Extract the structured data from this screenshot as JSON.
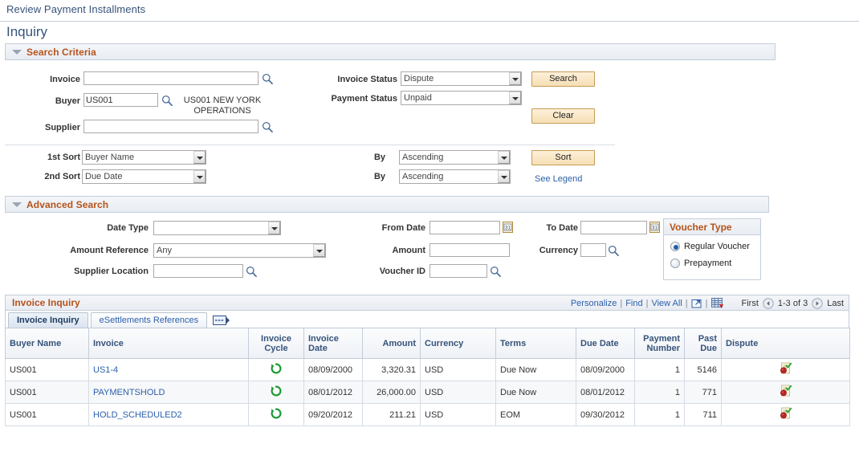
{
  "breadcrumb": "Review Payment Installments",
  "page_title": "Inquiry",
  "search_criteria": {
    "section_title": "Search Criteria",
    "invoice_label": "Invoice",
    "invoice_value": "",
    "buyer_label": "Buyer",
    "buyer_value": "US001",
    "buyer_description": "US001 NEW YORK OPERATIONS",
    "supplier_label": "Supplier",
    "supplier_value": "",
    "invoice_status_label": "Invoice Status",
    "invoice_status_value": "Dispute",
    "payment_status_label": "Payment Status",
    "payment_status_value": "Unpaid",
    "search_button": "Search",
    "clear_button": "Clear"
  },
  "sort": {
    "first_sort_label": "1st Sort",
    "first_sort_value": "Buyer Name",
    "second_sort_label": "2nd Sort",
    "second_sort_value": "Due Date",
    "by_label_1": "By",
    "by_value_1": "Ascending",
    "by_label_2": "By",
    "by_value_2": "Ascending",
    "sort_button": "Sort",
    "see_legend_link": "See Legend"
  },
  "advanced_search": {
    "section_title": "Advanced Search",
    "date_type_label": "Date Type",
    "date_type_value": "",
    "amount_reference_label": "Amount Reference",
    "amount_reference_value": "Any",
    "supplier_location_label": "Supplier Location",
    "supplier_location_value": "",
    "from_date_label": "From Date",
    "from_date_value": "",
    "amount_label": "Amount",
    "amount_value": "",
    "voucher_id_label": "Voucher ID",
    "voucher_id_value": "",
    "to_date_label": "To Date",
    "to_date_value": "",
    "currency_label": "Currency",
    "currency_value": "",
    "voucher_type": {
      "title": "Voucher Type",
      "options": [
        "Regular Voucher",
        "Prepayment"
      ],
      "selected": "Regular Voucher"
    }
  },
  "grid": {
    "title": "Invoice Inquiry",
    "tools": {
      "personalize": "Personalize",
      "find": "Find",
      "view_all": "View All",
      "first": "First",
      "range": "1-3 of 3",
      "last": "Last"
    },
    "tabs": [
      {
        "label": "Invoice Inquiry",
        "active": true
      },
      {
        "label": "eSettlements References",
        "active": false
      }
    ],
    "columns": [
      "Buyer Name",
      "Invoice",
      "Invoice Cycle",
      "Invoice Date",
      "Amount",
      "Currency",
      "Terms",
      "Due Date",
      "Payment Number",
      "Past Due",
      "Dispute"
    ],
    "rows": [
      {
        "buyer_name": "US001",
        "invoice": "US1-4",
        "invoice_cycle": "cycle-icon",
        "invoice_date": "08/09/2000",
        "amount": "3,320.31",
        "currency": "USD",
        "terms": "Due Now",
        "due_date": "08/09/2000",
        "payment_number": "1",
        "past_due": "5146",
        "dispute": "dispute-icon"
      },
      {
        "buyer_name": "US001",
        "invoice": "PAYMENTSHOLD",
        "invoice_cycle": "cycle-icon",
        "invoice_date": "08/01/2012",
        "amount": "26,000.00",
        "currency": "USD",
        "terms": "Due Now",
        "due_date": "08/01/2012",
        "payment_number": "1",
        "past_due": "771",
        "dispute": "dispute-icon"
      },
      {
        "buyer_name": "US001",
        "invoice": "HOLD_SCHEDULED2",
        "invoice_cycle": "cycle-icon",
        "invoice_date": "09/20/2012",
        "amount": "211.21",
        "currency": "USD",
        "terms": "EOM",
        "due_date": "09/30/2012",
        "payment_number": "1",
        "past_due": "711",
        "dispute": "dispute-icon"
      }
    ]
  },
  "colors": {
    "section_title": "#b5531b",
    "heading_blue": "#36537a",
    "link_blue": "#2b5faa",
    "button_gold": "#f6dfb4",
    "cycle_green": "#1a9a33"
  }
}
